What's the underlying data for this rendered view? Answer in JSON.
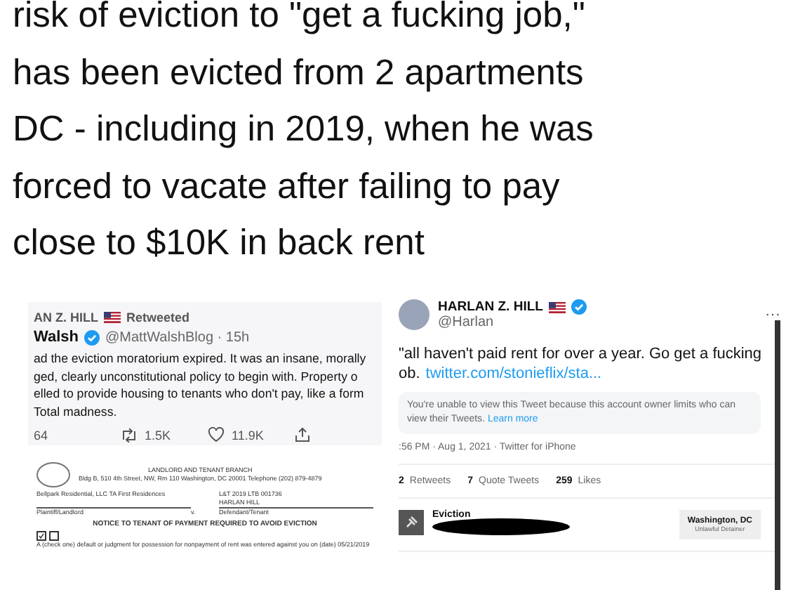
{
  "headline": {
    "lines": [
      "risk of eviction to \"get a fucking job,\"",
      "has been evicted from 2 apartments",
      "DC - including in 2019, when he was",
      "forced to vacate after failing to pay",
      "close to $10K in back rent"
    ]
  },
  "retweet": {
    "retweeter": "AN Z. HILL",
    "retweeted_label": "Retweeted",
    "author": "Walsh",
    "handle": "@MattWalshBlog · 15h",
    "lines": [
      "ad the eviction moratorium expired. It was an insane, morally",
      "ged, clearly unconstitutional policy to begin with. Property o",
      "elled to provide housing to tenants who don't pay, like a form",
      " Total madness."
    ],
    "actions": [
      {
        "kind": "reply",
        "count": "64"
      },
      {
        "kind": "retweet",
        "count": "1.5K"
      },
      {
        "kind": "like",
        "count": "11.9K"
      },
      {
        "kind": "share"
      }
    ]
  },
  "document": {
    "branch": "LANDLORD AND TENANT BRANCH",
    "address": "Bldg B, 510 4th Street, NW, Rm 110 Washington, DC 20001 Telephone (202) 879-4879",
    "plaintiff": "Bellpark Residential, LLC TA First Residences",
    "case_number": "L&T 2019 LTB 001736",
    "defendant": "HARLAN HILL",
    "plaintiff_role": "Plaintiff/Landlord",
    "versus": "v.",
    "defendant_role": "Defendant/Tenant",
    "notice_title": "NOTICE TO TENANT OF PAYMENT REQUIRED TO AVOID EVICTION",
    "default_checked": true,
    "judgment_checked": false,
    "notice_text": "A (check one) default or judgment for possession for nonpayment of rent was entered against you on (date) 05/21/2019"
  },
  "tweet": {
    "name": "HARLAN Z. HILL",
    "handle": "@Harlan",
    "more": "···",
    "text_lines": [
      "\"all haven't paid rent for over a year. Go get a fucking"
    ],
    "text_start": "ob.",
    "link": "twitter.com/stonieflix/sta...",
    "quoted_notice": "You're unable to view this Tweet because this account owner limits who can view their Tweets.",
    "learn_more": "Learn more",
    "timestamp": ":56 PM · Aug 1, 2021 · Twitter for iPhone",
    "stats": [
      {
        "count": "2",
        "label": "Retweets"
      },
      {
        "count": "7",
        "label": "Quote Tweets"
      },
      {
        "count": "259",
        "label": "Likes"
      }
    ],
    "card": {
      "title": "Eviction",
      "location": "Washington, DC",
      "case_type": "Unlawful Detainer"
    }
  }
}
